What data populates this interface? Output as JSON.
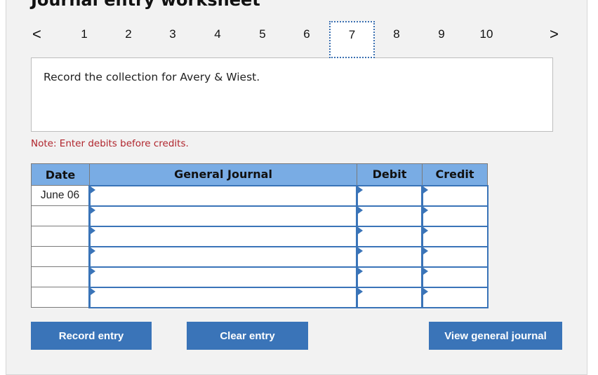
{
  "title": "Journal entry worksheet",
  "pagination": {
    "prev": "<",
    "next": ">",
    "pages": [
      "1",
      "2",
      "3",
      "4",
      "5",
      "6",
      "7",
      "8",
      "9",
      "10"
    ],
    "selected": "7"
  },
  "prompt": "Record the collection for Avery & Wiest.",
  "note": "Note: Enter debits before credits.",
  "table": {
    "headers": [
      "Date",
      "General Journal",
      "Debit",
      "Credit"
    ],
    "rows": [
      {
        "date": "June 06",
        "account": "",
        "debit": "",
        "credit": ""
      },
      {
        "date": "",
        "account": "",
        "debit": "",
        "credit": ""
      },
      {
        "date": "",
        "account": "",
        "debit": "",
        "credit": ""
      },
      {
        "date": "",
        "account": "",
        "debit": "",
        "credit": ""
      },
      {
        "date": "",
        "account": "",
        "debit": "",
        "credit": ""
      },
      {
        "date": "",
        "account": "",
        "debit": "",
        "credit": ""
      }
    ]
  },
  "buttons": {
    "record": "Record entry",
    "clear": "Clear entry",
    "view": "View general journal"
  },
  "colors": {
    "accent": "#3a74b8",
    "header": "#79ace4",
    "note": "#b0242c"
  }
}
